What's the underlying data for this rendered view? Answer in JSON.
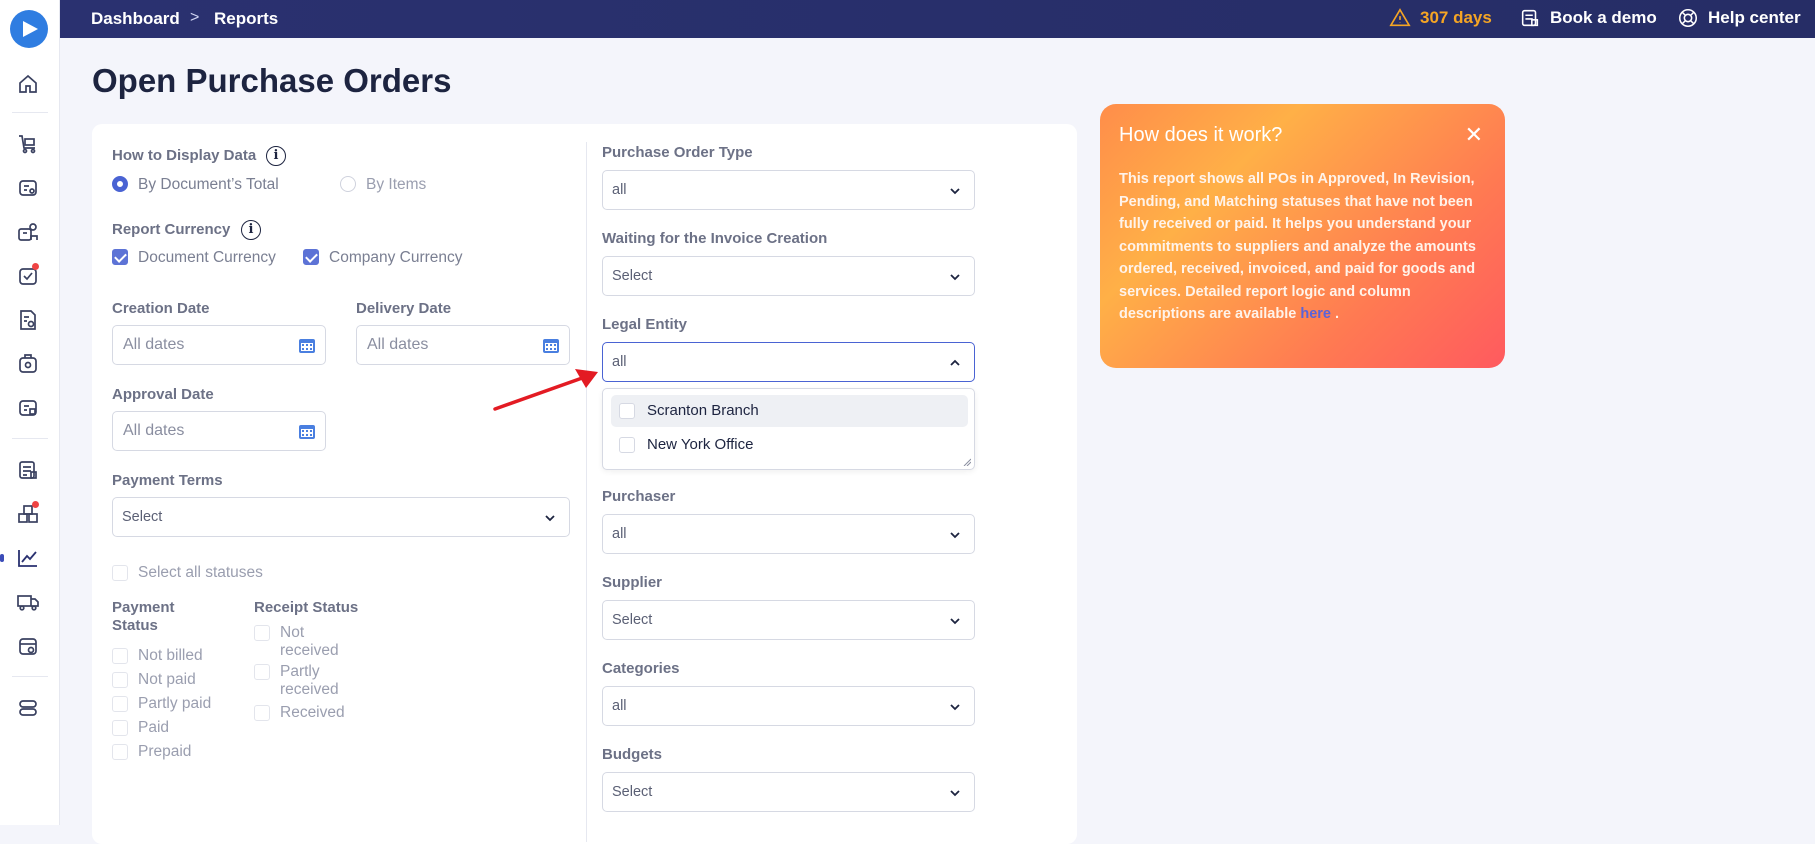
{
  "header": {
    "breadcrumb": [
      "Dashboard",
      "Reports"
    ],
    "trial_days": "307 days",
    "book_demo": "Book a demo",
    "help_center": "Help center"
  },
  "page": {
    "title": "Open Purchase Orders"
  },
  "display": {
    "label": "How to Display Data",
    "options": [
      "By Document’s Total",
      "By Items"
    ],
    "selected": "By Document’s Total"
  },
  "currency": {
    "label": "Report Currency",
    "options": [
      {
        "label": "Document Currency",
        "checked": true
      },
      {
        "label": "Company Currency",
        "checked": true
      }
    ]
  },
  "dates": {
    "creation_label": "Creation Date",
    "delivery_label": "Delivery Date",
    "approval_label": "Approval Date",
    "placeholder": "All dates"
  },
  "payment_terms": {
    "label": "Payment Terms",
    "value": "Select"
  },
  "statuses": {
    "select_all": "Select all statuses",
    "payment_label": "Payment Status",
    "payment_label_l1": "Payment",
    "payment_label_l2": "Status",
    "payment": [
      "Not billed",
      "Not paid",
      "Partly paid",
      "Paid",
      "Prepaid"
    ],
    "receipt_label": "Receipt Status",
    "receipt": [
      "Not received",
      "Partly received",
      "Received"
    ],
    "receipt_l1": [
      "Not",
      "Partly",
      "Received"
    ],
    "receipt_l2": [
      "received",
      "received",
      ""
    ]
  },
  "filters": {
    "po_type": {
      "label": "Purchase Order Type",
      "value": "all"
    },
    "invoice_wait": {
      "label": "Waiting for the Invoice Creation",
      "value": "Select"
    },
    "legal_entity": {
      "label": "Legal Entity",
      "value": "all",
      "options": [
        "Scranton Branch",
        "New York Office"
      ]
    },
    "purchaser": {
      "label": "Purchaser",
      "value": "all"
    },
    "supplier": {
      "label": "Supplier",
      "value": "Select"
    },
    "categories": {
      "label": "Categories",
      "value": "all"
    },
    "budgets": {
      "label": "Budgets",
      "value": "Select"
    }
  },
  "help": {
    "title": "How does it work?",
    "body": "This report shows all POs in Approved, In Revision, Pending, and Matching statuses that have not been fully received or paid. It helps you understand your commitments to suppliers and analyze the amounts ordered, received, invoiced, and paid for goods and services. Detailed report logic and column descriptions are available ",
    "link": "here",
    "after": " ."
  },
  "colors": {
    "accent": "#4a63d3",
    "topbar": "#2a3170",
    "warning": "#f5a524",
    "arrow": "#e31b23"
  }
}
